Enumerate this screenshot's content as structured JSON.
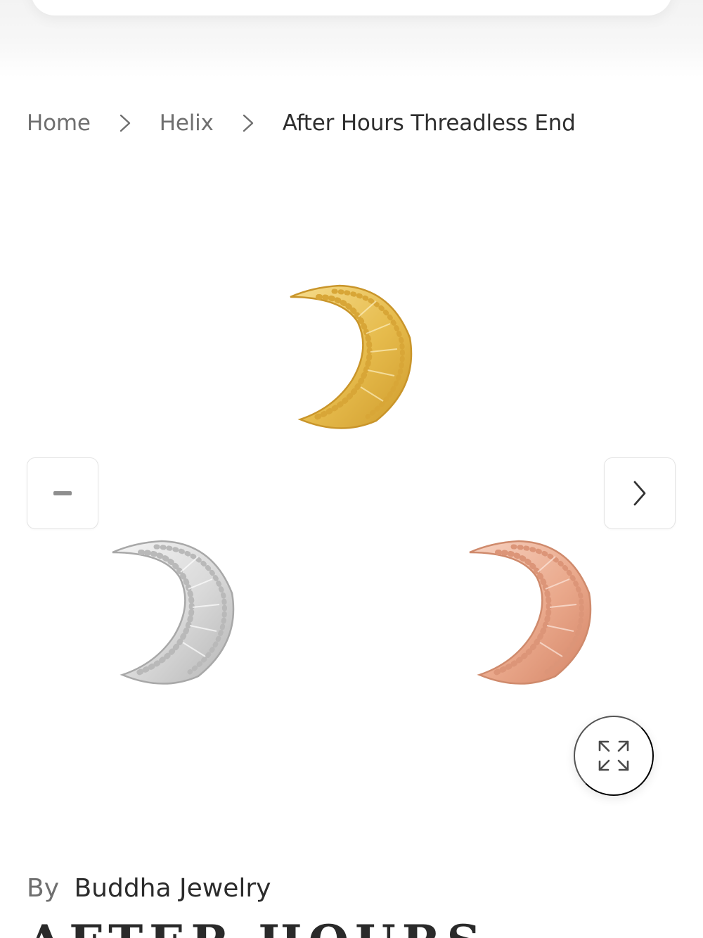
{
  "breadcrumb": {
    "items": [
      "Home",
      "Helix"
    ],
    "current": "After Hours Threadless End"
  },
  "gallery": {
    "variants": [
      {
        "finish": "gold",
        "color": "#e2b84a"
      },
      {
        "finish": "white-gold",
        "color": "#cfcfcf"
      },
      {
        "finish": "rose-gold",
        "color": "#e8a58a"
      }
    ],
    "icons": {
      "prev": "minus-icon",
      "next": "chevron-right-icon",
      "zoom": "expand-icon"
    }
  },
  "product": {
    "brand_prefix": "By",
    "brand_name": "Buddha Jewelry",
    "title": "AFTER HOURS"
  },
  "colors": {
    "muted_text": "#6f6f6f",
    "text": "#2b2b2b",
    "border": "#e4e4e4"
  }
}
